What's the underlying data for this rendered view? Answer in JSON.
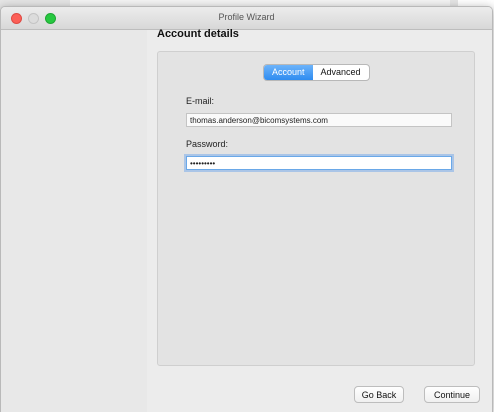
{
  "window": {
    "title": "Profile Wizard"
  },
  "page": {
    "section_title": "Account details"
  },
  "tabs": [
    {
      "label": "Account",
      "active": true
    },
    {
      "label": "Advanced",
      "active": false
    }
  ],
  "form": {
    "email_label": "E-mail:",
    "email_value": "thomas.anderson@bicomsystems.com",
    "password_label": "Password:",
    "password_value": "•••••••••"
  },
  "buttons": {
    "back_label": "Go Back",
    "continue_label": "Continue"
  },
  "colors": {
    "accent": "#2f8cf0",
    "close": "#fc5f57",
    "maximize": "#27c840"
  }
}
